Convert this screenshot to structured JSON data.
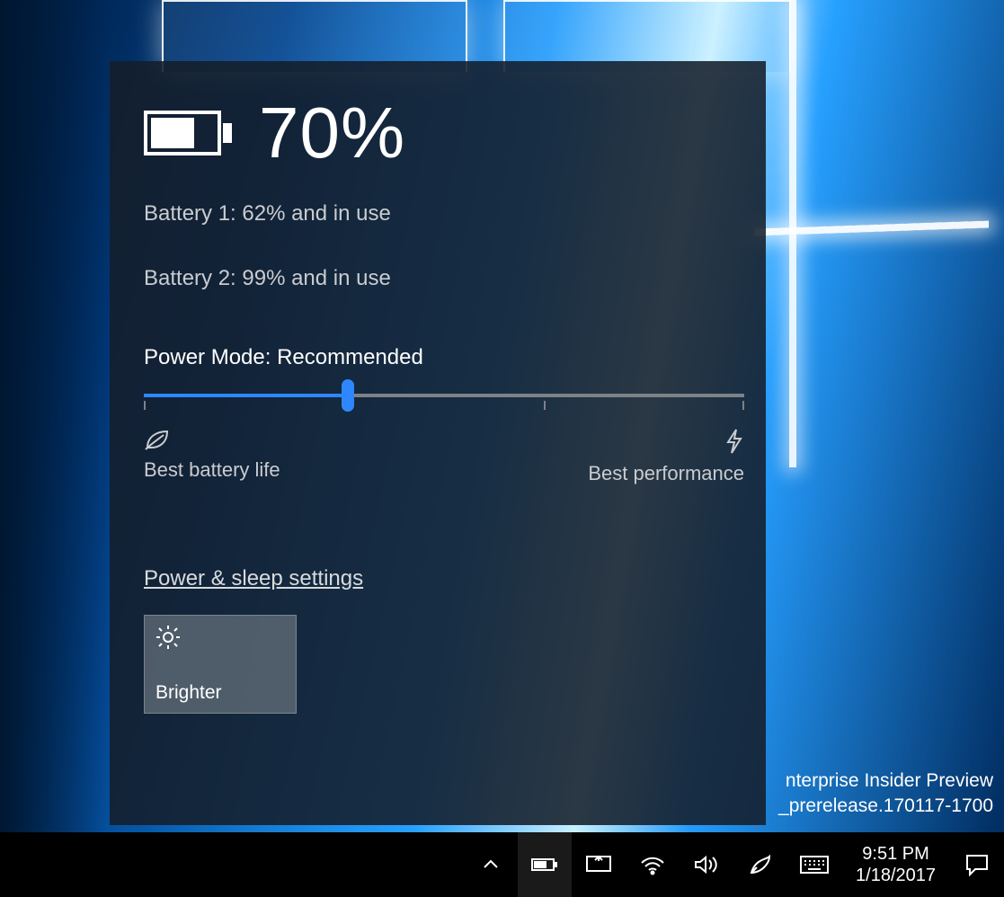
{
  "wallpaper": {
    "watermark_line1": "nterprise Insider Preview",
    "watermark_line2": "_prerelease.170117-1700"
  },
  "flyout": {
    "overall_percent": "70%",
    "battery1": "Battery 1: 62% and in use",
    "battery2": "Battery 2: 99% and in use",
    "power_mode_label": "Power Mode: Recommended",
    "slider": {
      "fill_percent": 34,
      "thumb_percent": 34
    },
    "left_label": "Best battery life",
    "right_label": "Best performance",
    "settings_link": "Power & sleep settings",
    "tile_label": "Brighter"
  },
  "taskbar": {
    "time": "9:51 PM",
    "date": "1/18/2017"
  },
  "colors": {
    "accent": "#2e87ff"
  }
}
